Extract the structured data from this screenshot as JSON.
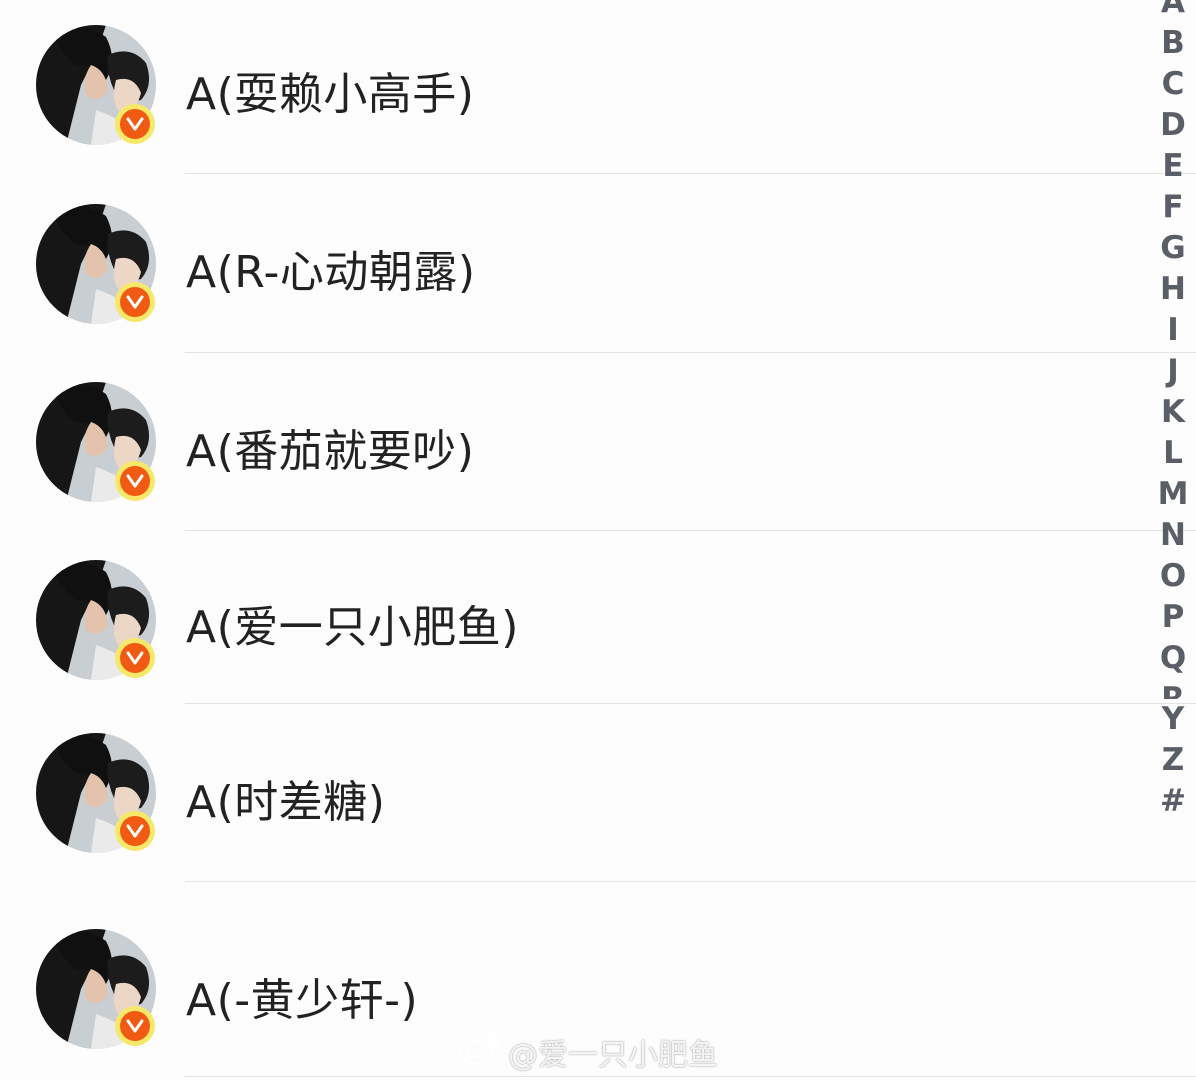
{
  "contacts": [
    {
      "name": "A(耍赖小高手)",
      "verified": "V"
    },
    {
      "name": "A(R-心动朝露)",
      "verified": "V"
    },
    {
      "name": "A(番茄就要吵)",
      "verified": "V"
    },
    {
      "name": "A(爱一只小肥鱼)",
      "verified": "V"
    },
    {
      "name": "A(时差糖)",
      "verified": "V"
    },
    {
      "name": "A(-黄少轩-)",
      "verified": "V"
    }
  ],
  "index_letters": [
    "A",
    "B",
    "C",
    "D",
    "E",
    "F",
    "G",
    "H",
    "I",
    "J",
    "K",
    "L",
    "M",
    "N",
    "O",
    "P",
    "Q",
    "R",
    "Y",
    "Z",
    "#"
  ],
  "watermark": {
    "text": "@爱一只小肥鱼",
    "icon": "weibo-logo-icon"
  },
  "colors": {
    "badge_outer": "#f7e86a",
    "badge_inner": "#f05a12",
    "index_text": "#5a5e66",
    "name_text": "#222222"
  }
}
